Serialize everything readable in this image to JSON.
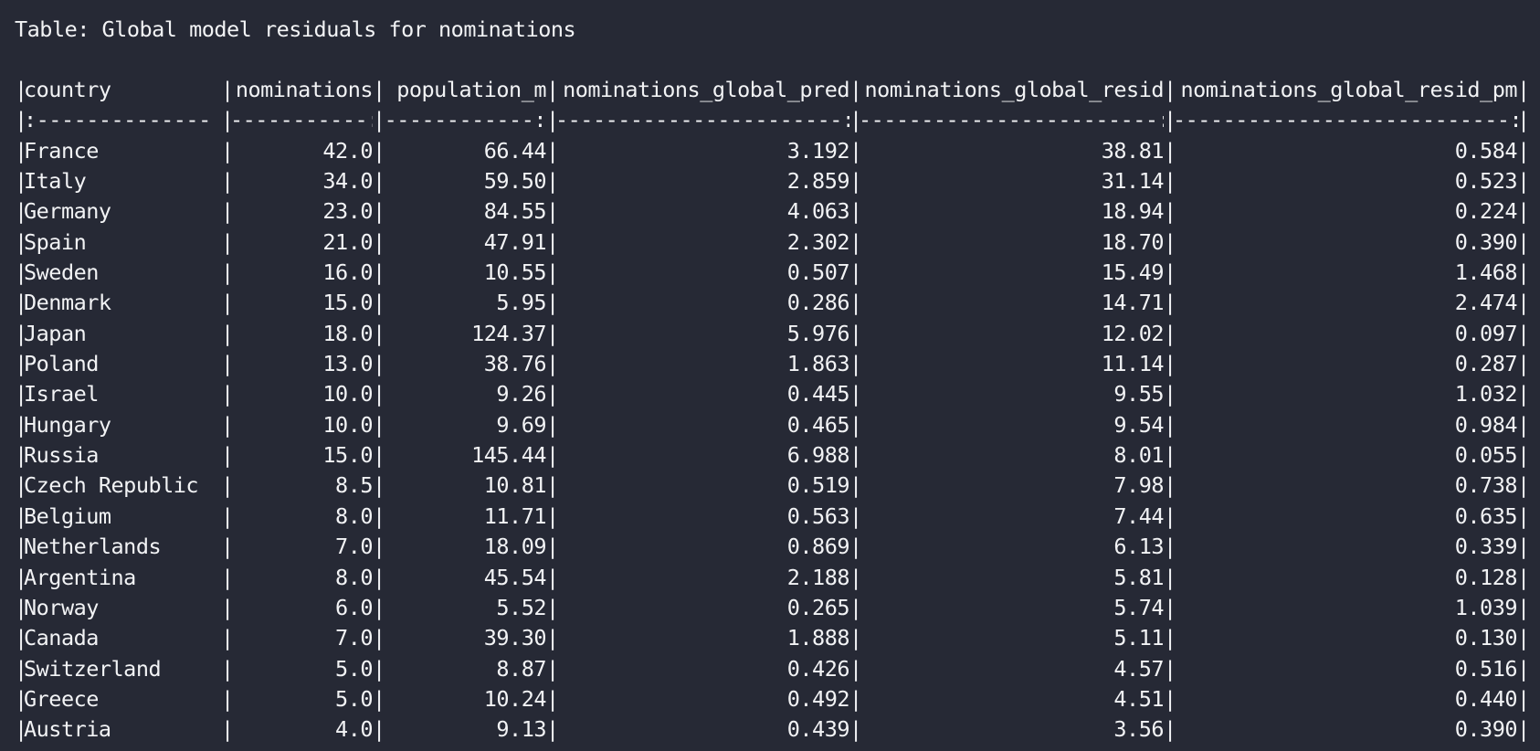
{
  "caption": "Table: Global model residuals for nominations",
  "columns": [
    "country",
    "nominations",
    "population_m",
    "nominations_global_pred",
    "nominations_global_resid",
    "nominations_global_resid_pm"
  ],
  "alignment_row": [
    ":--------------",
    "-----------:",
    "------------:",
    "-----------------------:",
    "------------------------:",
    "---------------------------:"
  ],
  "rows": [
    [
      "France",
      "42.0",
      "66.44",
      "3.192",
      "38.81",
      "0.584"
    ],
    [
      "Italy",
      "34.0",
      "59.50",
      "2.859",
      "31.14",
      "0.523"
    ],
    [
      "Germany",
      "23.0",
      "84.55",
      "4.063",
      "18.94",
      "0.224"
    ],
    [
      "Spain",
      "21.0",
      "47.91",
      "2.302",
      "18.70",
      "0.390"
    ],
    [
      "Sweden",
      "16.0",
      "10.55",
      "0.507",
      "15.49",
      "1.468"
    ],
    [
      "Denmark",
      "15.0",
      "5.95",
      "0.286",
      "14.71",
      "2.474"
    ],
    [
      "Japan",
      "18.0",
      "124.37",
      "5.976",
      "12.02",
      "0.097"
    ],
    [
      "Poland",
      "13.0",
      "38.76",
      "1.863",
      "11.14",
      "0.287"
    ],
    [
      "Israel",
      "10.0",
      "9.26",
      "0.445",
      "9.55",
      "1.032"
    ],
    [
      "Hungary",
      "10.0",
      "9.69",
      "0.465",
      "9.54",
      "0.984"
    ],
    [
      "Russia",
      "15.0",
      "145.44",
      "6.988",
      "8.01",
      "0.055"
    ],
    [
      "Czech Republic",
      "8.5",
      "10.81",
      "0.519",
      "7.98",
      "0.738"
    ],
    [
      "Belgium",
      "8.0",
      "11.71",
      "0.563",
      "7.44",
      "0.635"
    ],
    [
      "Netherlands",
      "7.0",
      "18.09",
      "0.869",
      "6.13",
      "0.339"
    ],
    [
      "Argentina",
      "8.0",
      "45.54",
      "2.188",
      "5.81",
      "0.128"
    ],
    [
      "Norway",
      "6.0",
      "5.52",
      "0.265",
      "5.74",
      "1.039"
    ],
    [
      "Canada",
      "7.0",
      "39.30",
      "1.888",
      "5.11",
      "0.130"
    ],
    [
      "Switzerland",
      "5.0",
      "8.87",
      "0.426",
      "4.57",
      "0.516"
    ],
    [
      "Greece",
      "5.0",
      "10.24",
      "0.492",
      "4.51",
      "0.440"
    ],
    [
      "Austria",
      "4.0",
      "9.13",
      "0.439",
      "3.56",
      "0.390"
    ]
  ],
  "colors": {
    "background": "#262935",
    "text": "#f2f3f5"
  }
}
